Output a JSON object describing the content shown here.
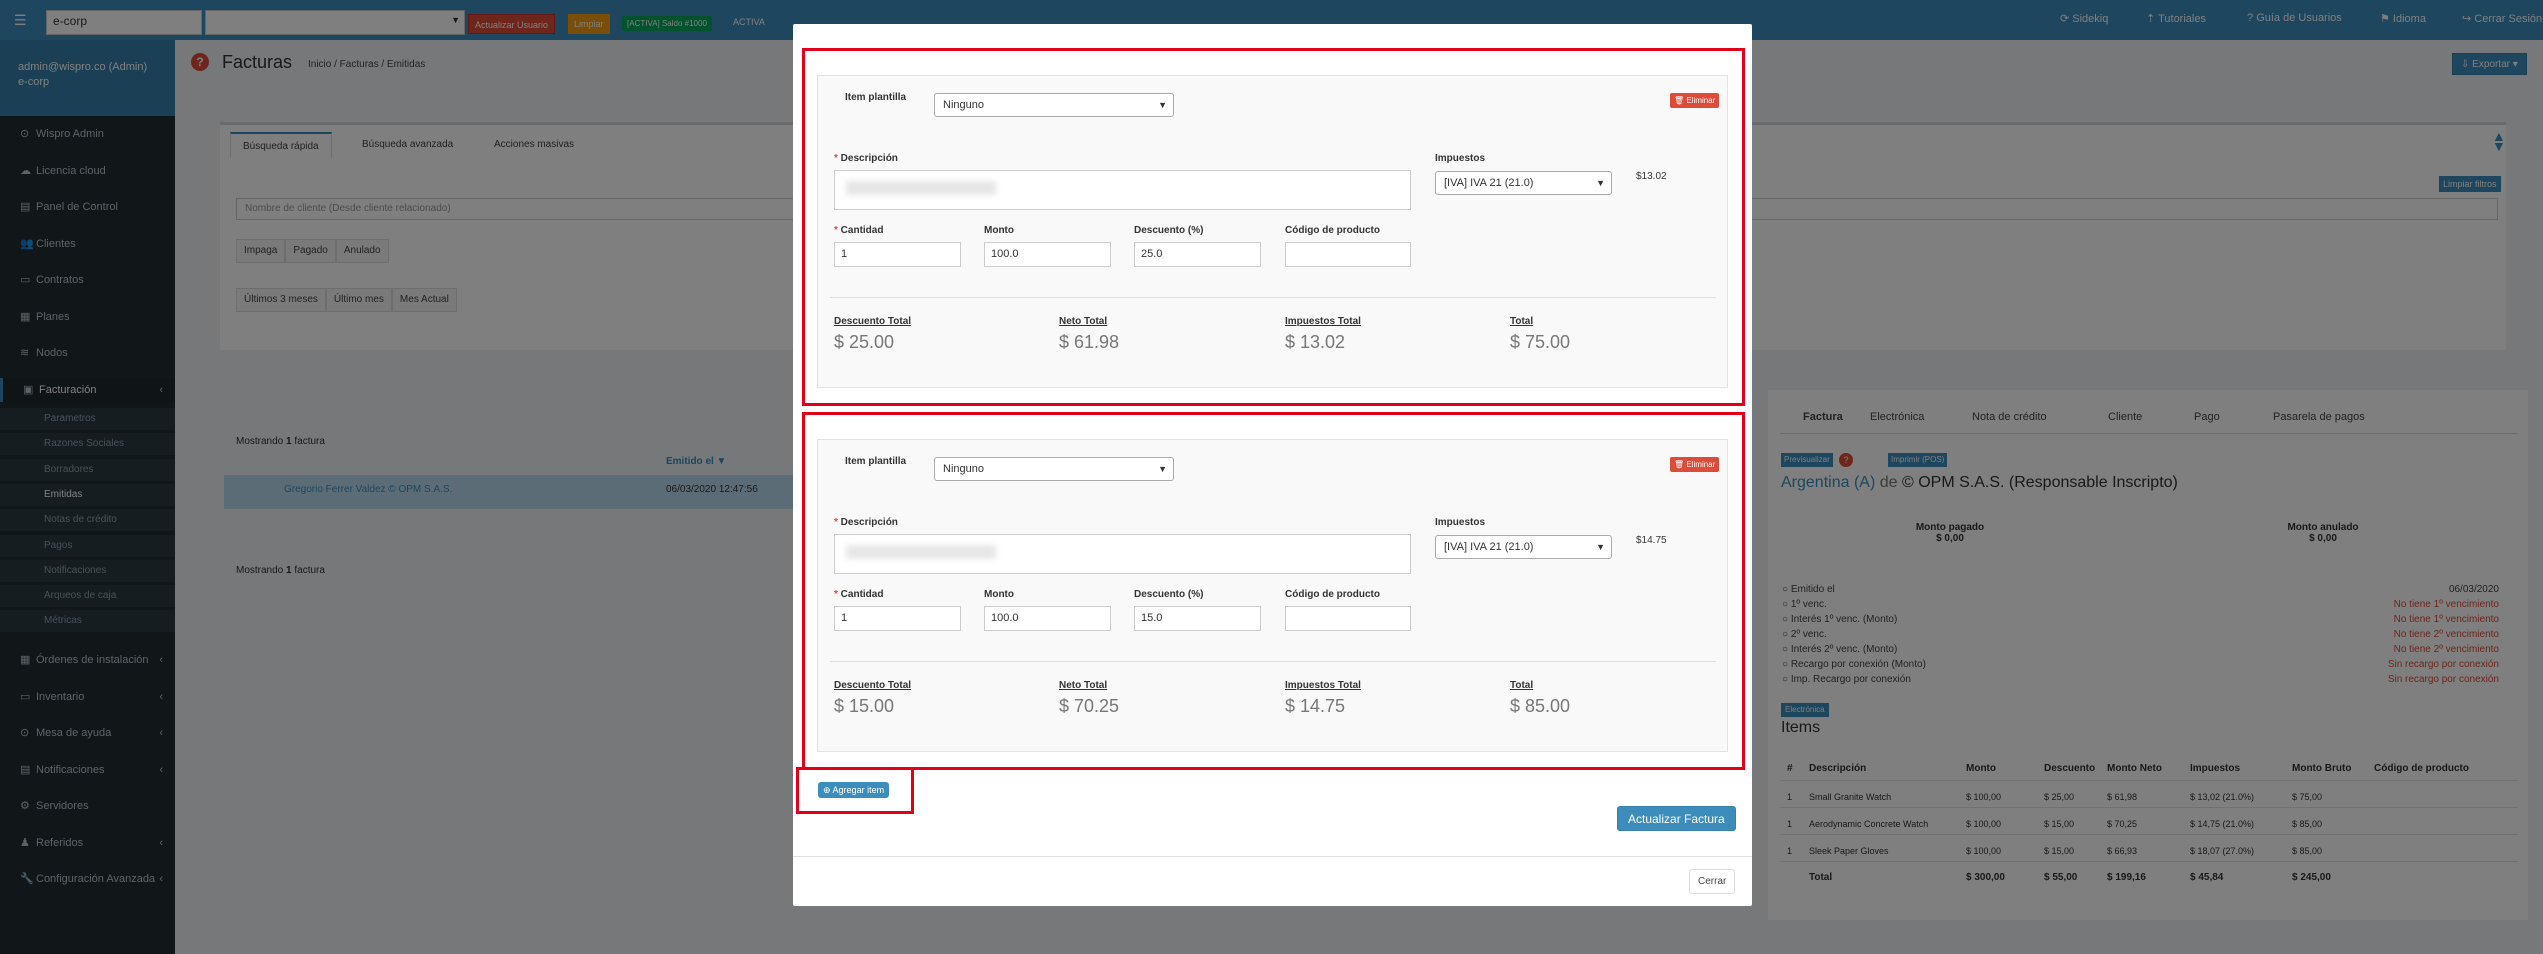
{
  "topbar": {
    "search_value": "e-corp",
    "update_user_label": "Actualizar Usuario",
    "clear_label": "Limpiar",
    "badge_active": "[ACTIVA] Saldo #1000",
    "active_text": "ACTIVA",
    "nav": [
      "Sidekiq",
      "Tutoriales",
      "Guía de Usuarios",
      "Idioma",
      "Cerrar Sesión"
    ]
  },
  "user_panel": {
    "name": "admin@wispro.co (Admin)",
    "company": "e-corp"
  },
  "sidebar": {
    "items": [
      {
        "icon": "⊙",
        "label": "Wispro Admin"
      },
      {
        "icon": "☁",
        "label": "Licencia cloud"
      },
      {
        "icon": "▤",
        "label": "Panel de Control"
      },
      {
        "icon": "👥",
        "label": "Clientes"
      },
      {
        "icon": "▭",
        "label": "Contratos"
      },
      {
        "icon": "▦",
        "label": "Planes"
      },
      {
        "icon": "≋",
        "label": "Nodos"
      },
      {
        "icon": "▣",
        "label": "Facturación"
      }
    ],
    "billing_sub": [
      "Parametros",
      "Razones Sociales",
      "Borradores",
      "Emitidas",
      "Notas de crédito",
      "Pagos",
      "Notificaciones",
      "Arqueos de caja",
      "Métricas"
    ],
    "items_after": [
      {
        "icon": "▦",
        "label": "Órdenes de instalación"
      },
      {
        "icon": "▭",
        "label": "Inventario"
      },
      {
        "icon": "⊙",
        "label": "Mesa de ayuda"
      },
      {
        "icon": "▤",
        "label": "Notificaciones"
      },
      {
        "icon": "⚙",
        "label": "Servidores"
      },
      {
        "icon": "♟",
        "label": "Referidos"
      },
      {
        "icon": "🔧",
        "label": "Configuración Avanzada"
      }
    ]
  },
  "page": {
    "title": "Facturas",
    "breadcrumb": "Inicio / Facturas / Emitidas",
    "export_label": "Exportar",
    "tabs": [
      "Búsqueda rápida",
      "Búsqueda avanzada",
      "Acciones masivas"
    ],
    "client_filter_placeholder": "Nombre de cliente (Desde cliente relacionado)",
    "status_filters": [
      "Impaga",
      "Pagado",
      "Anulado"
    ],
    "date_filters": [
      "Últimos 3 meses",
      "Último mes",
      "Mes Actual"
    ],
    "clear_filters": "Limpiar filtros",
    "showing_prefix": "Mostrando",
    "showing_count": "1",
    "showing_suffix": "factura",
    "emitted_header": "Emitido el ▼",
    "row_client": "Gregorio Ferrer Valdez © OPM S.A.S.",
    "row_date": "06/03/2020 12:47:56"
  },
  "right_panel": {
    "tabs": [
      "Factura",
      "Electrónica",
      "Nota de crédito",
      "Cliente",
      "Pago",
      "Pasarela de pagos"
    ],
    "preview_label": "Previsualizar",
    "print_label": "Imprimir (POS)",
    "country": "Argentina (A)",
    "de": "de",
    "company": "© OPM S.A.S. (Responsable Inscripto)",
    "paid_label": "Monto pagado",
    "paid_value": "$ 0,00",
    "void_label": "Monto anulado",
    "void_value": "$ 0,00",
    "details": [
      {
        "label": "Emitido el",
        "value": "06/03/2020",
        "red": false
      },
      {
        "label": "1º venc.",
        "value": "No tiene 1º vencimiento",
        "red": true
      },
      {
        "label": "Interés 1º venc. (Monto)",
        "value": "No tiene 1º vencimiento",
        "red": true
      },
      {
        "label": "2º venc.",
        "value": "No tiene 2º vencimiento",
        "red": true
      },
      {
        "label": "Interés 2º venc. (Monto)",
        "value": "No tiene 2º vencimiento",
        "red": true
      },
      {
        "label": "Recargo por conexión (Monto)",
        "value": "Sin recargo por conexión",
        "red": true
      },
      {
        "label": "Imp. Recargo por conexión",
        "value": "Sin recargo por conexión",
        "red": true
      }
    ],
    "electronic_badge": "Electrónica",
    "items_title": "Items",
    "table_headers": [
      "#",
      "Descripción",
      "Monto",
      "Descuento",
      "Monto Neto",
      "Impuestos",
      "Monto Bruto",
      "Código de producto"
    ],
    "table_rows": [
      [
        "1",
        "Small Granite Watch",
        "$ 100,00",
        "$ 25,00",
        "$ 61,98",
        "$ 13,02 (21.0%)",
        "$ 75,00",
        ""
      ],
      [
        "1",
        "Aerodynamic Concrete Watch",
        "$ 100,00",
        "$ 15,00",
        "$ 70,25",
        "$ 14,75 (21.0%)",
        "$ 85,00",
        ""
      ],
      [
        "1",
        "Sleek Paper Gloves",
        "$ 100,00",
        "$ 15,00",
        "$ 66,93",
        "$ 18,07 (27.0%)",
        "$ 85,00",
        ""
      ]
    ],
    "table_total": [
      "",
      "Total",
      "$ 300,00",
      "$ 55,00",
      "$ 199,16",
      "$ 45,84",
      "$ 245,00",
      ""
    ]
  },
  "modal": {
    "template_label": "Item plantilla",
    "template_value": "Ninguno",
    "delete_label": "Eliminar",
    "description_label": "Descripción",
    "taxes_label": "Impuestos",
    "tax_value": "[IVA] IVA 21 (21.0)",
    "quantity_label": "Cantidad",
    "amount_label": "Monto",
    "discount_label": "Descuento (%)",
    "product_code_label": "Código de producto",
    "total_discount_label": "Descuento Total",
    "net_total_label": "Neto Total",
    "taxes_total_label": "Impuestos Total",
    "total_label": "Total",
    "items": [
      {
        "tax_amount": "$13.02",
        "quantity": "1",
        "amount": "100.0",
        "discount": "25.0",
        "total_discount": "$ 25.00",
        "net_total": "$ 61.98",
        "taxes_total": "$ 13.02",
        "total": "$ 75.00"
      },
      {
        "tax_amount": "$14.75",
        "quantity": "1",
        "amount": "100.0",
        "discount": "15.0",
        "total_discount": "$ 15.00",
        "net_total": "$ 70.25",
        "taxes_total": "$ 14.75",
        "total": "$ 85.00"
      }
    ],
    "add_item_label": "Agregar item",
    "update_label": "Actualizar Factura",
    "close_label": "Cerrar"
  }
}
